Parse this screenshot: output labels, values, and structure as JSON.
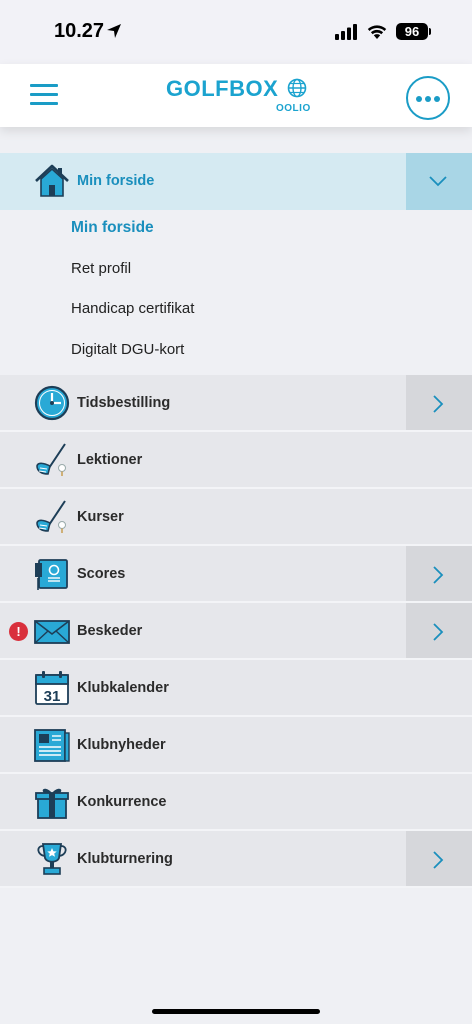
{
  "status_bar": {
    "time": "10.27",
    "battery": "96"
  },
  "header": {
    "logo_text": "GOLFBOX",
    "logo_sub": "OOLIO"
  },
  "colors": {
    "accent": "#1a9cc6",
    "alert": "#d9303c"
  },
  "menu": {
    "active": {
      "label": "Min forside",
      "icon": "home-icon"
    },
    "submenu": [
      {
        "label": "Min forside"
      },
      {
        "label": "Ret profil"
      },
      {
        "label": "Handicap certifikat"
      },
      {
        "label": "Digitalt DGU-kort"
      }
    ],
    "items": [
      {
        "label": "Tidsbestilling",
        "icon": "clock-icon"
      },
      {
        "label": "Lektioner",
        "icon": "golf-club-icon"
      },
      {
        "label": "Kurser",
        "icon": "golf-club-icon"
      },
      {
        "label": "Scores",
        "icon": "scorecard-icon"
      },
      {
        "label": "Beskeder",
        "icon": "envelope-icon",
        "alert": "!"
      },
      {
        "label": "Klubkalender",
        "icon": "calendar-icon",
        "calendar_day": "31"
      },
      {
        "label": "Klubnyheder",
        "icon": "newspaper-icon"
      },
      {
        "label": "Konkurrence",
        "icon": "gift-icon"
      },
      {
        "label": "Klubturnering",
        "icon": "trophy-icon"
      }
    ]
  }
}
